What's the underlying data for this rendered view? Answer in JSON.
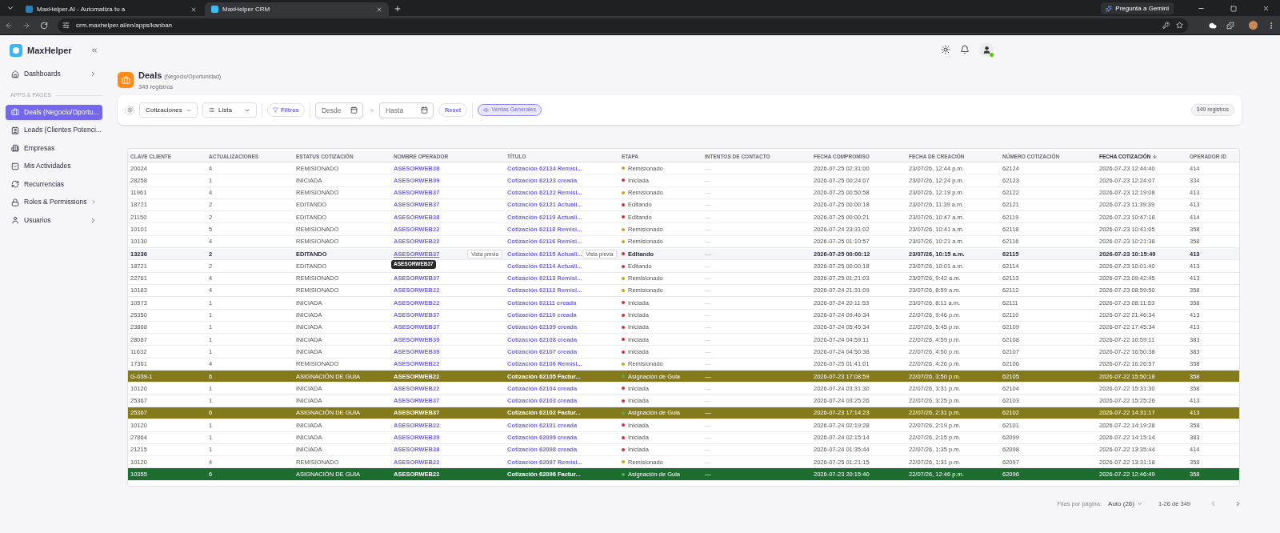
{
  "browser": {
    "tabs": [
      {
        "title": "MaxHelper.AI - Automatiza tu a",
        "selected": false
      },
      {
        "title": "MaxHelper CRM",
        "selected": true
      }
    ],
    "url": "crm.maxhelper.ai/en/apps/kanban",
    "gemini": "Pregunta a Gemini"
  },
  "sidebar": {
    "brand": "MaxHelper",
    "top_items": [
      {
        "label": "Dashboards",
        "has_children": true,
        "selected": false
      }
    ],
    "section": "APPS & PAGES",
    "app_items": [
      {
        "label": "Deals (Negocio/Oportu...",
        "has_children": false,
        "selected": true
      },
      {
        "label": "Leads (Clientes Potenci...",
        "has_children": false,
        "selected": false
      },
      {
        "label": "Empresas",
        "has_children": false,
        "selected": false
      },
      {
        "label": "Mis Actividades",
        "has_children": false,
        "selected": false
      },
      {
        "label": "Recurrencias",
        "has_children": false,
        "selected": false
      },
      {
        "label": "Roles & Permissions",
        "has_children": true,
        "selected": false
      },
      {
        "label": "Usuarios",
        "has_children": true,
        "selected": false
      }
    ]
  },
  "header": {
    "online": true
  },
  "page": {
    "title": "Deals",
    "subtitle": "(Negocio/Oportunidad)",
    "count": "349 registros"
  },
  "toolbar": {
    "pipeline": "Cotizaciones",
    "view": "Lista",
    "filters": "Filtros",
    "from_placeholder": "Desde",
    "to_placeholder": "Hasta",
    "reset": "Reset",
    "chip": "Ventas Generales",
    "total": "349 registros"
  },
  "table": {
    "columns": [
      {
        "label": "CLAVE CLIENTE",
        "sorted": false
      },
      {
        "label": "ACTUALIZACIONES",
        "sorted": false
      },
      {
        "label": "ESTATUS COTIZACIÓN",
        "sorted": false
      },
      {
        "label": "NOMBRE OPERADOR",
        "sorted": false
      },
      {
        "label": "TÍTULO",
        "sorted": false
      },
      {
        "label": "ETAPA",
        "sorted": false
      },
      {
        "label": "INTENTOS DE CONTACTO",
        "sorted": false
      },
      {
        "label": "FECHA COMPROMISO",
        "sorted": false
      },
      {
        "label": "FECHA DE CREACIÓN",
        "sorted": false
      },
      {
        "label": "NÚMERO COTIZACIÓN",
        "sorted": false
      },
      {
        "label": "FECHA COTIZACIÓN",
        "sorted": true
      },
      {
        "label": "OPERADOR ID",
        "sorted": false
      }
    ],
    "hover": {
      "tooltip": "ASESORWEB37",
      "operator_preview": "Vista previa",
      "title_preview": "Vista previa"
    },
    "rows": [
      {
        "client": "20024",
        "updates": "4",
        "status": "REMISIONADO",
        "operator": "ASESORWEB38",
        "title": "Cotización 62124 Remisi...",
        "stage": {
          "label": "Remisionado",
          "color": "#c9a227"
        },
        "attempts": "—",
        "commit_date": "2026-07-25 02:31:00",
        "created": "23/07/26, 12:44 p.m.",
        "number": "62124",
        "quote_date": "2026-07-23 12:44:40",
        "operator_id": "414",
        "color": "#ffffff",
        "hovered": false
      },
      {
        "client": "28258",
        "updates": "1",
        "status": "INICIADA",
        "operator": "ASESORWEB99",
        "title": "Cotización 62123 creada",
        "stage": {
          "label": "Iniciada",
          "color": "#d32f2f"
        },
        "attempts": "—",
        "commit_date": "2026-07-25 00:24:07",
        "created": "23/07/26, 12:24 p.m.",
        "number": "62123",
        "quote_date": "2026-07-23 12:24:07",
        "operator_id": "334",
        "color": "#ffffff",
        "hovered": false
      },
      {
        "client": "11961",
        "updates": "4",
        "status": "REMISIONADO",
        "operator": "ASESORWEB37",
        "title": "Cotización 62122 Remisi...",
        "stage": {
          "label": "Remisionado",
          "color": "#c9a227"
        },
        "attempts": "—",
        "commit_date": "2026-07-25 00:50:58",
        "created": "23/07/26, 12:19 p.m.",
        "number": "62122",
        "quote_date": "2026-07-23 12:19:08",
        "operator_id": "413",
        "color": "#ffffff",
        "hovered": false
      },
      {
        "client": "18721",
        "updates": "2",
        "status": "EDITANDO",
        "operator": "ASESORWEB37",
        "title": "Cotización 62121 Actuali...",
        "stage": {
          "label": "Editando",
          "color": "#d32f2f"
        },
        "attempts": "—",
        "commit_date": "2026-07-25 00:00:18",
        "created": "23/07/26, 11:39 a.m.",
        "number": "62121",
        "quote_date": "2026-07-23 11:39:39",
        "operator_id": "413",
        "color": "#ffffff",
        "hovered": false
      },
      {
        "client": "21150",
        "updates": "2",
        "status": "EDITANDO",
        "operator": "ASESORWEB38",
        "title": "Cotización 62119 Actuali...",
        "stage": {
          "label": "Editando",
          "color": "#d32f2f"
        },
        "attempts": "—",
        "commit_date": "2026-07-25 00:00:21",
        "created": "23/07/26, 10:47 a.m.",
        "number": "62119",
        "quote_date": "2026-07-23 10:47:18",
        "operator_id": "414",
        "color": "#ffffff",
        "hovered": false
      },
      {
        "client": "10101",
        "updates": "5",
        "status": "REMISIONADO",
        "operator": "ASESORWEB22",
        "title": "Cotización 62118 Remisi...",
        "stage": {
          "label": "Remisionado",
          "color": "#c9a227"
        },
        "attempts": "—",
        "commit_date": "2026-07-24 23:31:02",
        "created": "23/07/26, 10:41 a.m.",
        "number": "62118",
        "quote_date": "2026-07-23 10:41:05",
        "operator_id": "358",
        "color": "#ffffff",
        "hovered": false
      },
      {
        "client": "10130",
        "updates": "4",
        "status": "REMISIONADO",
        "operator": "ASESORWEB22",
        "title": "Cotización 62116 Remisi...",
        "stage": {
          "label": "Remisionado",
          "color": "#c9a227"
        },
        "attempts": "—",
        "commit_date": "2026-07-25 01:10:57",
        "created": "23/07/26, 10:21 a.m.",
        "number": "62116",
        "quote_date": "2026-07-23 10:21:38",
        "operator_id": "358",
        "color": "#ffffff",
        "hovered": false
      },
      {
        "client": "13236",
        "updates": "2",
        "status": "EDITANDO",
        "operator": "ASESORWEB37",
        "title": "Cotización 62115 Actuali...",
        "stage": {
          "label": "Editando",
          "color": "#d32f2f"
        },
        "attempts": "—",
        "commit_date": "2026-07-25 00:00:12",
        "created": "23/07/26, 10:15 a.m.",
        "number": "62115",
        "quote_date": "2026-07-23 10:15:49",
        "operator_id": "413",
        "color": "#ffffff",
        "hovered": true
      },
      {
        "client": "18721",
        "updates": "2",
        "status": "EDITANDO",
        "title": "Cotización 62114 Actuali...",
        "stage": {
          "label": "Editando",
          "color": "#d32f2f"
        },
        "attempts": "—",
        "commit_date": "2026-07-25 00:00:18",
        "created": "23/07/26, 10:01 a.m.",
        "number": "62114",
        "quote_date": "2026-07-23 10:01:40",
        "operator_id": "413",
        "color": "#ffffff",
        "hovered": false
      },
      {
        "client": "22761",
        "updates": "4",
        "status": "REMISIONADO",
        "operator": "ASESORWEB37",
        "title": "Cotización 62113 Remisi...",
        "stage": {
          "label": "Remisionado",
          "color": "#c9a227"
        },
        "attempts": "—",
        "commit_date": "2026-07-25 01:21:03",
        "created": "23/07/26, 9:42 a.m.",
        "number": "62113",
        "quote_date": "2026-07-23 09:42:45",
        "operator_id": "413",
        "color": "#ffffff",
        "hovered": false
      },
      {
        "client": "10183",
        "updates": "4",
        "status": "REMISIONADO",
        "operator": "ASESORWEB22",
        "title": "Cotización 62112 Remisi...",
        "stage": {
          "label": "Remisionado",
          "color": "#c9a227"
        },
        "attempts": "—",
        "commit_date": "2026-07-24 21:31:09",
        "created": "23/07/26, 8:59 a.m.",
        "number": "62112",
        "quote_date": "2026-07-23 08:59:50",
        "operator_id": "358",
        "color": "#ffffff",
        "hovered": false
      },
      {
        "client": "10573",
        "updates": "1",
        "status": "INICIADA",
        "operator": "ASESORWEB22",
        "title": "Cotización 62111 creada",
        "stage": {
          "label": "Iniciada",
          "color": "#d32f2f"
        },
        "attempts": "—",
        "commit_date": "2026-07-24 20:11:53",
        "created": "23/07/26, 8:11 a.m.",
        "number": "62111",
        "quote_date": "2026-07-23 08:11:53",
        "operator_id": "358",
        "color": "#ffffff",
        "hovered": false
      },
      {
        "client": "25350",
        "updates": "1",
        "status": "INICIADA",
        "operator": "ASESORWEB37",
        "title": "Cotización 62110 creada",
        "stage": {
          "label": "Iniciada",
          "color": "#d32f2f"
        },
        "attempts": "—",
        "commit_date": "2026-07-24 09:46:34",
        "created": "22/07/26, 9:46 p.m.",
        "number": "62110",
        "quote_date": "2026-07-22 21:46:34",
        "operator_id": "413",
        "color": "#ffffff",
        "hovered": false
      },
      {
        "client": "23868",
        "updates": "1",
        "status": "INICIADA",
        "operator": "ASESORWEB37",
        "title": "Cotización 62109 creada",
        "stage": {
          "label": "Iniciada",
          "color": "#d32f2f"
        },
        "attempts": "—",
        "commit_date": "2026-07-24 05:45:34",
        "created": "22/07/26, 5:45 p.m.",
        "number": "62109",
        "quote_date": "2026-07-22 17:45:34",
        "operator_id": "413",
        "color": "#ffffff",
        "hovered": false
      },
      {
        "client": "28087",
        "updates": "1",
        "status": "INICIADA",
        "operator": "ASESORWEB39",
        "title": "Cotización 62108 creada",
        "stage": {
          "label": "Iniciada",
          "color": "#d32f2f"
        },
        "attempts": "—",
        "commit_date": "2026-07-24 04:59:11",
        "created": "22/07/26, 4:59 p.m.",
        "number": "62108",
        "quote_date": "2026-07-22 16:59:11",
        "operator_id": "383",
        "color": "#ffffff",
        "hovered": false
      },
      {
        "client": "11632",
        "updates": "1",
        "status": "INICIADA",
        "operator": "ASESORWEB39",
        "title": "Cotización 62107 creada",
        "stage": {
          "label": "Iniciada",
          "color": "#d32f2f"
        },
        "attempts": "—",
        "commit_date": "2026-07-24 04:50:38",
        "created": "22/07/26, 4:50 p.m.",
        "number": "62107",
        "quote_date": "2026-07-22 16:50:38",
        "operator_id": "383",
        "color": "#ffffff",
        "hovered": false
      },
      {
        "client": "17361",
        "updates": "4",
        "status": "REMISIONADO",
        "operator": "ASESORWEB22",
        "title": "Cotización 62106 Remisi...",
        "stage": {
          "label": "Remisionado",
          "color": "#c9a227"
        },
        "attempts": "—",
        "commit_date": "2026-07-25 01:41:01",
        "created": "22/07/26, 4:26 p.m.",
        "number": "62106",
        "quote_date": "2026-07-22 16:26:57",
        "operator_id": "358",
        "color": "#ffffff",
        "hovered": false
      },
      {
        "client": "G-039-1",
        "updates": "6",
        "status": "ASIGNACIÓN DE GUIA",
        "operator": "ASESORWEB22",
        "title": "Cotización 62105 Factur...",
        "stage": {
          "label": "Asignación de Guia",
          "color": "#4caf50"
        },
        "attempts": "—",
        "commit_date": "2026-07-23 17:08:59",
        "created": "22/07/26, 3:50 p.m.",
        "number": "62105",
        "quote_date": "2026-07-22 15:50:18",
        "operator_id": "358",
        "color": "#857a1b",
        "hovered": false
      },
      {
        "client": "10120",
        "updates": "1",
        "status": "INICIADA",
        "operator": "ASESORWEB22",
        "title": "Cotización 62104 creada",
        "stage": {
          "label": "Iniciada",
          "color": "#d32f2f"
        },
        "attempts": "—",
        "commit_date": "2026-07-24 03:31:30",
        "created": "22/07/26, 3:31 p.m.",
        "number": "62104",
        "quote_date": "2026-07-22 15:31:30",
        "operator_id": "358",
        "color": "#ffffff",
        "hovered": false
      },
      {
        "client": "25367",
        "updates": "1",
        "status": "INICIADA",
        "operator": "ASESORWEB37",
        "title": "Cotización 62103 creada",
        "stage": {
          "label": "Iniciada",
          "color": "#d32f2f"
        },
        "attempts": "—",
        "commit_date": "2026-07-24 03:25:26",
        "created": "22/07/26, 3:25 p.m.",
        "number": "62103",
        "quote_date": "2026-07-22 15:25:26",
        "operator_id": "413",
        "color": "#ffffff",
        "hovered": false
      },
      {
        "client": "25367",
        "updates": "6",
        "status": "ASIGNACIÓN DE GUIA",
        "operator": "ASESORWEB37",
        "title": "Cotización 62102 Factur...",
        "stage": {
          "label": "Asignación de Guia",
          "color": "#4caf50"
        },
        "attempts": "—",
        "commit_date": "2026-07-23 17:14:23",
        "created": "22/07/26, 2:31 p.m.",
        "number": "62102",
        "quote_date": "2026-07-22 14:31:17",
        "operator_id": "413",
        "color": "#857a1b",
        "hovered": false
      },
      {
        "client": "10120",
        "updates": "1",
        "status": "INICIADA",
        "operator": "ASESORWEB22",
        "title": "Cotización 62101 creada",
        "stage": {
          "label": "Iniciada",
          "color": "#d32f2f"
        },
        "attempts": "—",
        "commit_date": "2026-07-24 02:19:28",
        "created": "22/07/26, 2:19 p.m.",
        "number": "62101",
        "quote_date": "2026-07-22 14:19:28",
        "operator_id": "358",
        "color": "#ffffff",
        "hovered": false
      },
      {
        "client": "27864",
        "updates": "1",
        "status": "INICIADA",
        "operator": "ASESORWEB39",
        "title": "Cotización 62099 creada",
        "stage": {
          "label": "Iniciada",
          "color": "#d32f2f"
        },
        "attempts": "—",
        "commit_date": "2026-07-24 02:15:14",
        "created": "22/07/26, 2:15 p.m.",
        "number": "62099",
        "quote_date": "2026-07-22 14:15:14",
        "operator_id": "383",
        "color": "#ffffff",
        "hovered": false
      },
      {
        "client": "21215",
        "updates": "1",
        "status": "INICIADA",
        "operator": "ASESORWEB38",
        "title": "Cotización 62098 creada",
        "stage": {
          "label": "Iniciada",
          "color": "#d32f2f"
        },
        "attempts": "—",
        "commit_date": "2026-07-24 01:35:44",
        "created": "22/07/26, 1:35 p.m.",
        "number": "62098",
        "quote_date": "2026-07-22 13:35:44",
        "operator_id": "414",
        "color": "#ffffff",
        "hovered": false
      },
      {
        "client": "10120",
        "updates": "4",
        "status": "REMISIONADO",
        "operator": "ASESORWEB22",
        "title": "Cotización 62097 Remisi...",
        "stage": {
          "label": "Remisionado",
          "color": "#c9a227"
        },
        "attempts": "—",
        "commit_date": "2026-07-25 01:21:15",
        "created": "22/07/26, 1:31 p.m.",
        "number": "62097",
        "quote_date": "2026-07-22 13:31:18",
        "operator_id": "358",
        "color": "#ffffff",
        "hovered": false
      },
      {
        "client": "10355",
        "updates": "6",
        "status": "ASIGNACIÓN DE GUIA",
        "operator": "ASESORWEB22",
        "title": "Cotización 62096 Factur...",
        "stage": {
          "label": "Asignación de Guia",
          "color": "#4caf50"
        },
        "attempts": "—",
        "commit_date": "2026-07-23 20:15:40",
        "created": "22/07/26, 12:46 p.m.",
        "number": "62096",
        "quote_date": "2026-07-22 12:46:49",
        "operator_id": "358",
        "color": "#1b6e2e",
        "hovered": false
      }
    ]
  },
  "pagination": {
    "label": "Filas por página:",
    "per_page": "Auto (26)",
    "range": "1-26 de 349"
  }
}
